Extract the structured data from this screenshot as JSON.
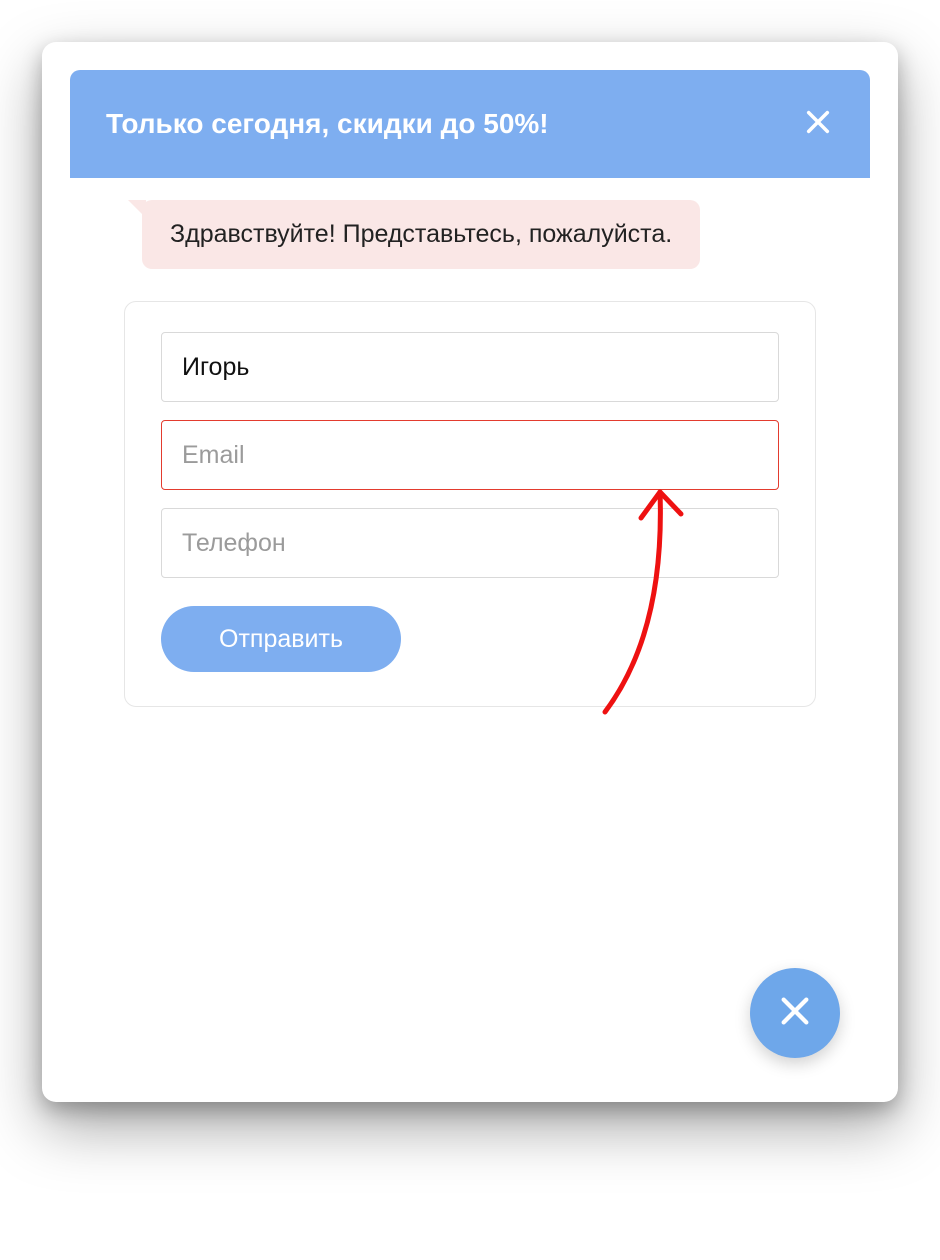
{
  "header": {
    "title": "Только сегодня, скидки до 50%!"
  },
  "chat": {
    "greeting": "Здравствуйте! Представьтесь, пожалуйста."
  },
  "form": {
    "name_value": "Игорь",
    "email_placeholder": "Email",
    "email_value": "",
    "email_invalid": true,
    "phone_placeholder": "Телефон",
    "phone_value": "",
    "submit_label": "Отправить"
  },
  "colors": {
    "accent": "#7eaef0",
    "bubble_bg": "#fae7e6",
    "error": "#e33b2e"
  }
}
